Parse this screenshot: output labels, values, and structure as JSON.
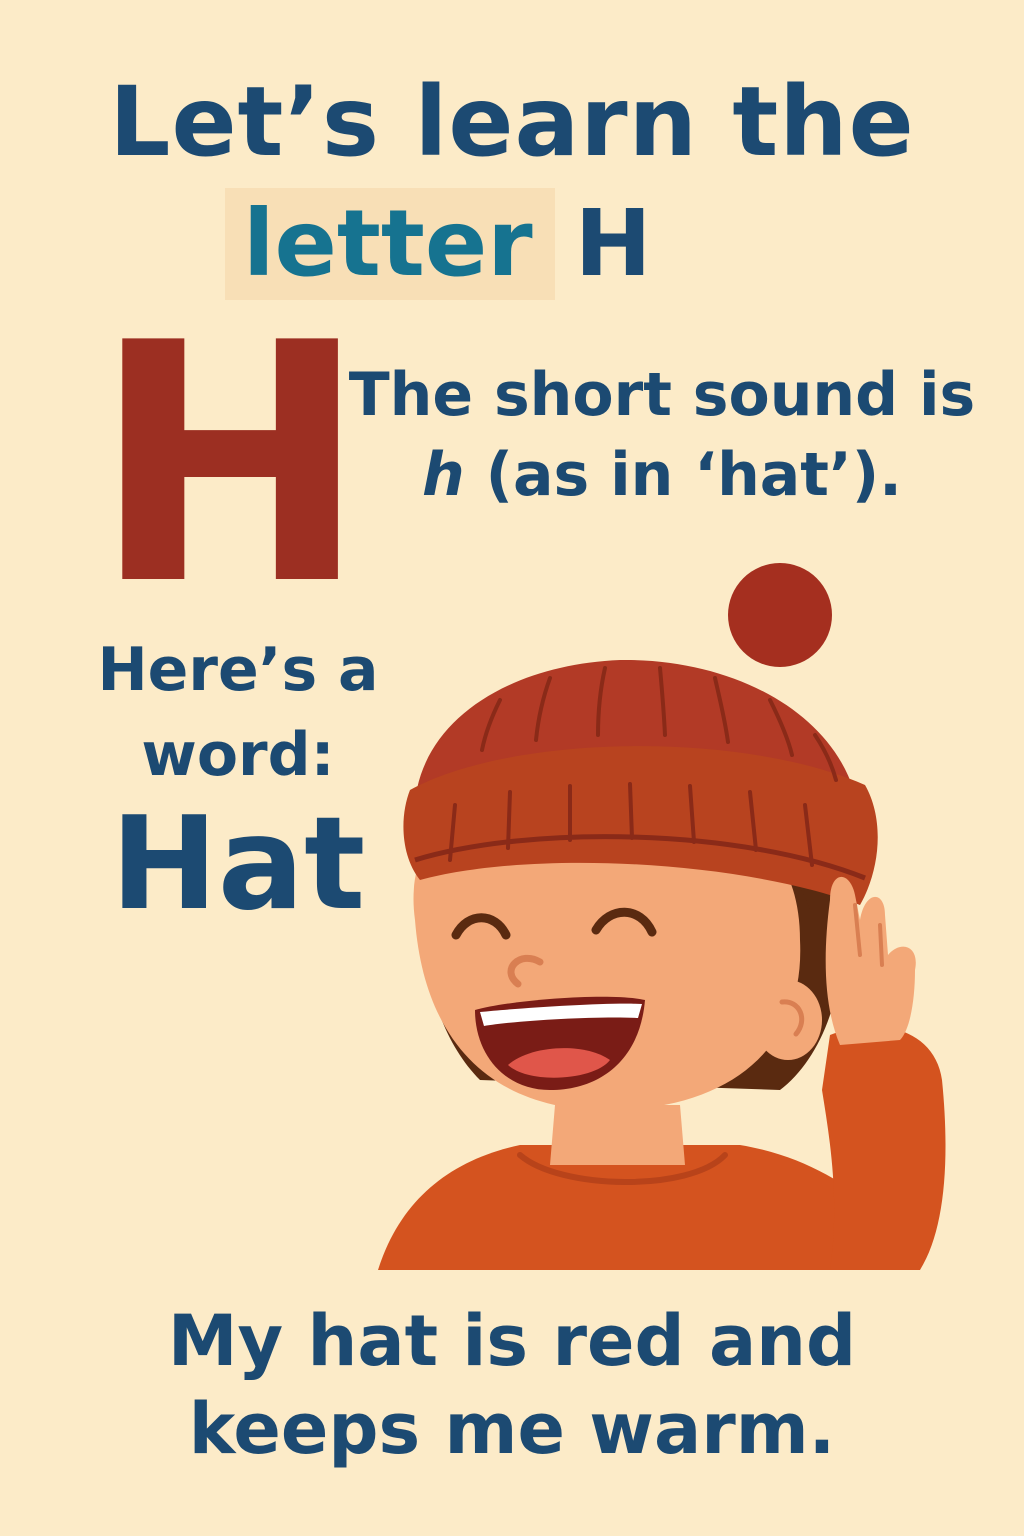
{
  "title": {
    "line1": "Let’s learn the",
    "highlight": "letter",
    "letter": "H"
  },
  "big_letter": "H",
  "sound": {
    "line1": "The short sound is",
    "italic": "h",
    "line2_rest": " (as in ‘hat’)."
  },
  "word_intro": {
    "line1": "Here’s a",
    "line2": "word:"
  },
  "word": "Hat",
  "sentence": {
    "line1": "My hat is red and",
    "line2": "keeps me warm."
  },
  "icons": {
    "illustration": "boy-in-red-hat-illustration"
  },
  "colors": {
    "background": "#fcebc8",
    "text": "#1c4a72",
    "highlight_text": "#167390",
    "highlight_bg": "#f8dfb6",
    "big_letter": "#9c2f22",
    "hat": "#b23a26",
    "sweater": "#d4531f",
    "skin": "#f3a878",
    "hair": "#5a2a10"
  }
}
